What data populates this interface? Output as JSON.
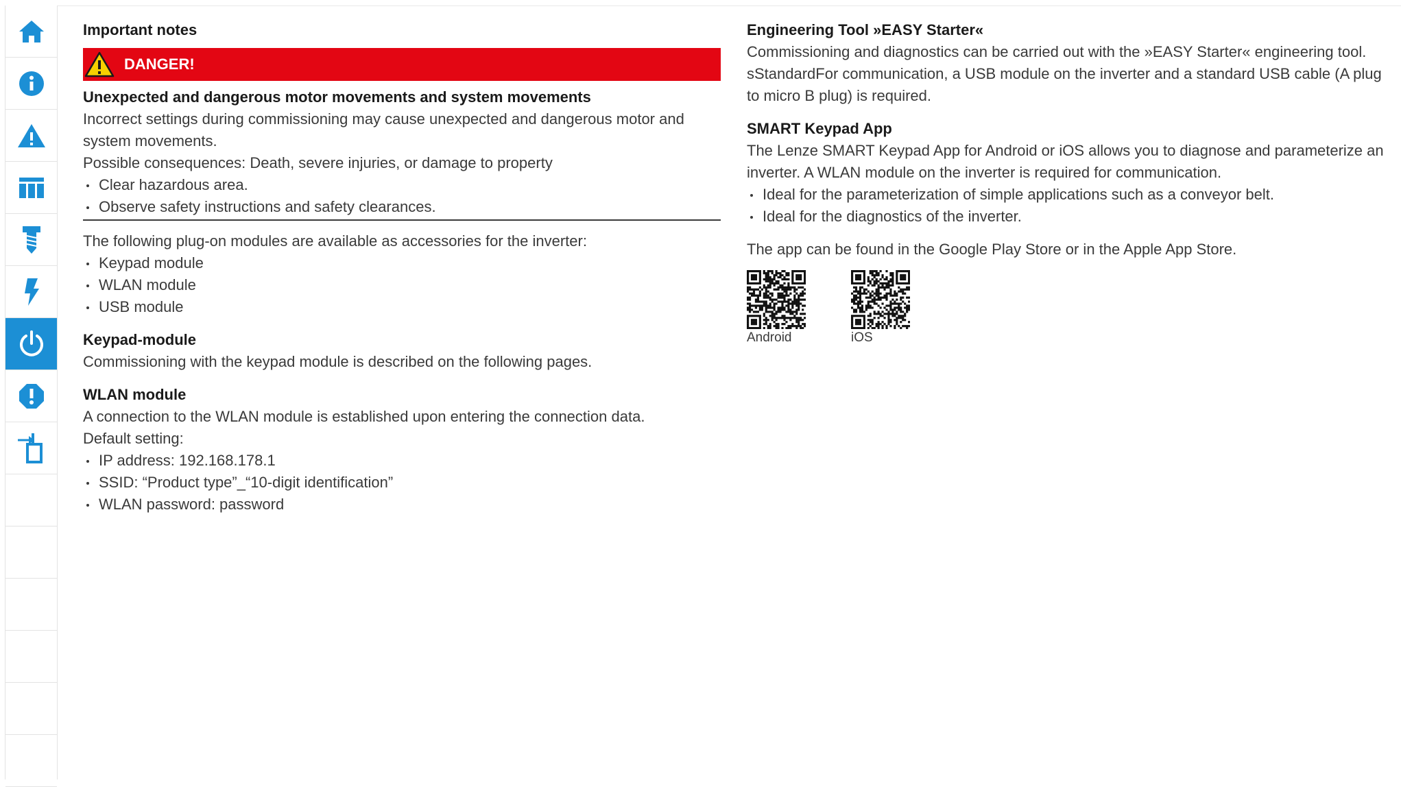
{
  "nav": [
    {
      "icon": "home-icon",
      "active": false
    },
    {
      "icon": "info-icon",
      "active": false
    },
    {
      "icon": "warning-icon",
      "active": false
    },
    {
      "icon": "table-icon",
      "active": false
    },
    {
      "icon": "screw-icon",
      "active": false
    },
    {
      "icon": "lightning-icon",
      "active": false
    },
    {
      "icon": "power-icon",
      "active": true
    },
    {
      "icon": "alert-octagon-icon",
      "active": false
    },
    {
      "icon": "import-icon",
      "active": false
    }
  ],
  "colors": {
    "accent": "#1c8fd5",
    "danger": "#e30613",
    "text": "#3a3a3a"
  },
  "left": {
    "notes_title": "Important notes",
    "danger_label": "DANGER!",
    "danger_heading": "Unexpected and dangerous motor movements and system movements",
    "danger_text": "Incorrect settings during commissioning may cause unexpected and dangerous motor and system movements.",
    "consequences": "Possible consequences: Death, severe injuries, or damage to property",
    "danger_bullets": [
      "Clear hazardous area.",
      "Observe safety instructions and safety clearances."
    ],
    "modules_intro": "The following plug-on modules are available as accessories for the inverter:",
    "modules": [
      "Keypad module",
      "WLAN module",
      "USB module"
    ],
    "keypad_title": "Keypad-module",
    "keypad_text": "Commissioning with the keypad module is described on the following pages.",
    "wlan_title": "WLAN module",
    "wlan_text": "A connection to the WLAN module is established upon entering the connection data.",
    "wlan_default": "Default setting:",
    "wlan_bullets": [
      "IP address: 192.168.178.1",
      "SSID: “Product type”_“10-digit identification”",
      "WLAN password: password"
    ]
  },
  "right": {
    "easy_title": "Engineering Tool »EASY Starter«",
    "easy_text": "Commissioning and diagnostics can be carried out with the »EASY Starter« engineering tool. sStandardFor communication, a USB module on the inverter and a standard USB cable (A plug to micro B plug) is required.",
    "smart_title": "SMART Keypad App",
    "smart_text": "The Lenze SMART Keypad App for Android or iOS allows you to diagnose and parameterize an inverter. A WLAN module on the inverter is required for communication.",
    "smart_bullets": [
      "Ideal for the parameterization of simple applications such as a conveyor belt.",
      "Ideal for the diagnostics of the inverter."
    ],
    "store_text": "The app can be found in the Google Play Store or in the Apple App Store.",
    "qr": [
      {
        "caption": "Android"
      },
      {
        "caption": "iOS"
      }
    ]
  }
}
